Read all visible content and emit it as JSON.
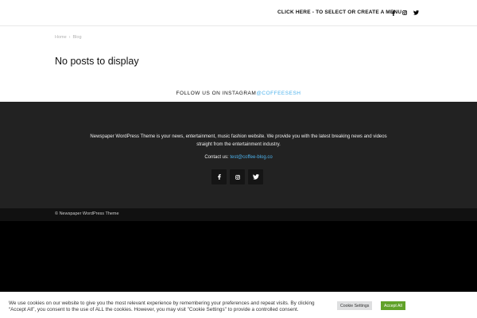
{
  "header": {
    "menu_link": "CLICK HERE - TO SELECT OR CREATE A MENU",
    "social": [
      "facebook-icon",
      "instagram-icon",
      "twitter-icon"
    ]
  },
  "breadcrumb": {
    "items": [
      "Home",
      "Blog"
    ],
    "separator": "›"
  },
  "main": {
    "title": "No posts to display"
  },
  "instagram": {
    "label": "FOLLOW US ON INSTAGRAM",
    "handle": "@COFFEESESH"
  },
  "footer": {
    "about": "Newspaper WordPress Theme is your news, entertainment, music fashion website. We provide you with the latest breaking news and videos straight from the entertainment industry.",
    "contact_label": "Contact us:",
    "contact_email": "test@coffee-blog.co",
    "social": [
      "facebook-icon",
      "instagram-icon",
      "twitter-icon"
    ]
  },
  "subfooter": {
    "copyright": "© Newspaper WordPress Theme"
  },
  "cookie": {
    "text": "We use cookies on our website to give you the most relevant experience by remembering your preferences and repeat visits. By clicking “Accept All”, you consent to the use of ALL the cookies. However, you may visit \"Cookie Settings\" to provide a controlled consent.",
    "settings_label": "Cookie Settings",
    "accept_label": "Accept All"
  },
  "colors": {
    "accent": "#4db2ec",
    "footer_bg": "#222222",
    "accept_button": "#61a229"
  }
}
